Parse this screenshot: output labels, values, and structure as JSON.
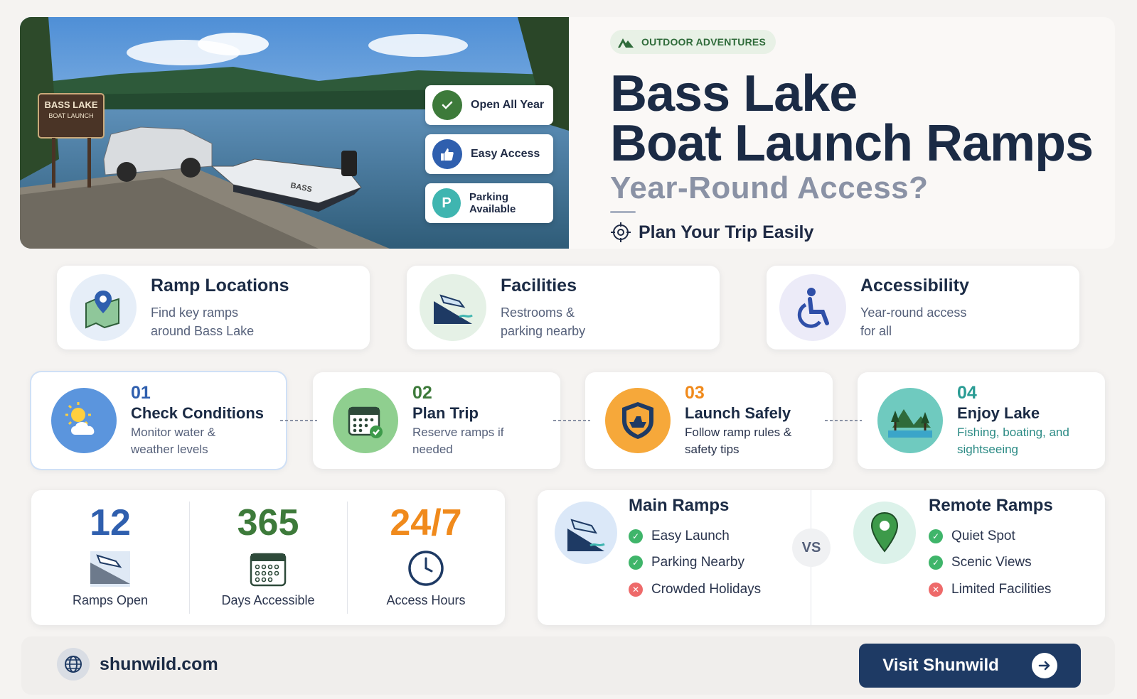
{
  "hero": {
    "sign_line1": "BASS LAKE",
    "sign_line2": "BOAT LAUNCH",
    "boat_text": "BASS",
    "badges": [
      {
        "label": "Open All Year",
        "icon": "check-icon",
        "color": "#3d7a3a"
      },
      {
        "label": "Easy Access",
        "icon": "thumbs-up-icon",
        "color": "#2f5fae"
      },
      {
        "label": "Parking Available",
        "icon": "parking-icon",
        "glyph": "P",
        "color": "#3fb5b0"
      }
    ]
  },
  "header": {
    "tag": "OUTDOOR ADVENTURES",
    "title_line1": "Bass Lake",
    "title_line2": "Boat Launch Ramps",
    "subtitle": "Year-Round Access?",
    "plan": "Plan Your Trip Easily"
  },
  "features": [
    {
      "title": "Ramp Locations",
      "desc": "Find key ramps around Bass Lake",
      "icon": "map-pin-icon"
    },
    {
      "title": "Facilities",
      "desc": "Restrooms & parking nearby",
      "icon": "boat-ramp-icon"
    },
    {
      "title": "Accessibility",
      "desc": "Year-round access for all",
      "icon": "wheelchair-icon"
    }
  ],
  "steps": [
    {
      "num": "01",
      "title": "Check Conditions",
      "desc": "Monitor water & weather levels",
      "num_color": "#2f5fae",
      "desc_color": "#55607a",
      "icon": "weather-icon"
    },
    {
      "num": "02",
      "title": "Plan Trip",
      "desc": "Reserve ramps if needed",
      "num_color": "#3d7a3a",
      "desc_color": "#55607a",
      "icon": "calendar-icon"
    },
    {
      "num": "03",
      "title": "Launch Safely",
      "desc": "Follow ramp rules & safety tips",
      "num_color": "#f08a1c",
      "desc_color": "#2a344d",
      "icon": "shield-boat-icon"
    },
    {
      "num": "04",
      "title": "Enjoy Lake",
      "desc": "Fishing, boating, and sightseeing",
      "num_color": "#2a9c94",
      "desc_color": "#2a8a84",
      "icon": "lake-trees-icon"
    }
  ],
  "stats": [
    {
      "value": "12",
      "label": "Ramps Open",
      "color": "#2f5fae",
      "icon": "boat-ramp-icon"
    },
    {
      "value": "365",
      "label": "Days Accessible",
      "color": "#3d7a3a",
      "icon": "calendar-icon"
    },
    {
      "value": "24/7",
      "label": "Access Hours",
      "color": "#f08a1c",
      "icon": "clock-icon"
    }
  ],
  "compare": {
    "vs": "VS",
    "left": {
      "title": "Main Ramps",
      "items": [
        {
          "text": "Easy Launch",
          "type": "pro"
        },
        {
          "text": "Parking Nearby",
          "type": "pro"
        },
        {
          "text": "Crowded Holidays",
          "type": "con"
        }
      ]
    },
    "right": {
      "title": "Remote Ramps",
      "items": [
        {
          "text": "Quiet Spot",
          "type": "pro"
        },
        {
          "text": "Scenic Views",
          "type": "pro"
        },
        {
          "text": "Limited Facilities",
          "type": "con"
        }
      ]
    }
  },
  "footer": {
    "site": "shunwild.com",
    "cta": "Visit Shunwild"
  },
  "colors": {
    "navy": "#1e3a64",
    "green": "#3d7a3a",
    "orange": "#f08a1c",
    "blue": "#2f5fae",
    "teal": "#2a9c94",
    "pro": "#3fb56a",
    "con": "#ee6a6a"
  }
}
